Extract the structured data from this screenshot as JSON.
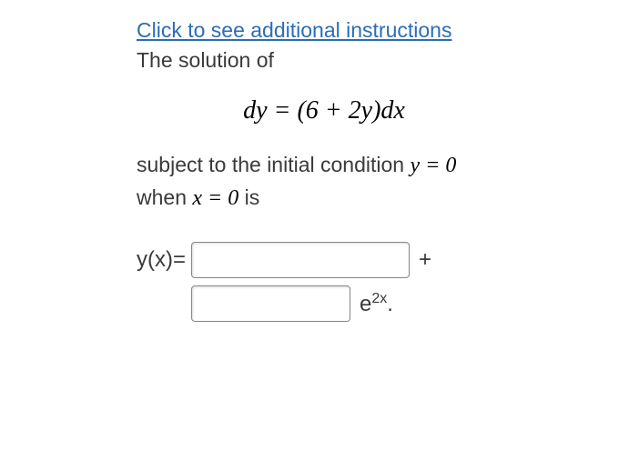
{
  "link_text": "Click to see additional instructions",
  "intro": "The solution of",
  "equation": "dy = (6 + 2y)dx",
  "subject_prefix": "subject to the initial condition ",
  "subject_math": "y = 0",
  "when_prefix": "when ",
  "when_math": "x = 0",
  "when_suffix": " is",
  "yx_label": "y(x)=",
  "plus": "+",
  "e2x_base": "e",
  "e2x_exp": "2x",
  "e2x_period": ".",
  "input1_value": "",
  "input2_value": ""
}
